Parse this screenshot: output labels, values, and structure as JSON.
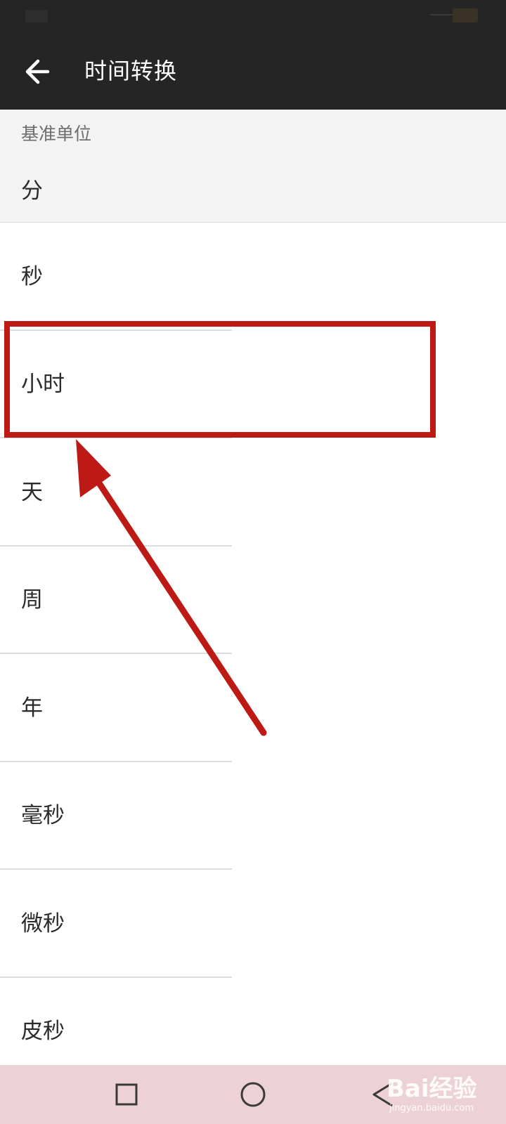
{
  "app_bar": {
    "title": "时间转换",
    "back_icon": "arrow-left-icon"
  },
  "base_unit": {
    "label": "基准单位",
    "value": "分"
  },
  "units": [
    {
      "label": "秒"
    },
    {
      "label": "小时"
    },
    {
      "label": "天"
    },
    {
      "label": "周"
    },
    {
      "label": "年"
    },
    {
      "label": "毫秒"
    },
    {
      "label": "微秒"
    },
    {
      "label": "皮秒"
    }
  ],
  "annotation": {
    "highlighted_item": "小时",
    "color": "#be1a15"
  },
  "navigation_bar": {
    "recents_icon": "square-icon",
    "home_icon": "circle-icon",
    "back_icon": "triangle-back-icon"
  },
  "watermark": {
    "logo": "Bai经验",
    "url": "jingyan.baidu.com"
  },
  "colors": {
    "app_bar_background": "#252525",
    "base_section_background": "#f3f3f3",
    "nav_bar_background": "#ecd1d6",
    "highlight": "#be1a15"
  }
}
